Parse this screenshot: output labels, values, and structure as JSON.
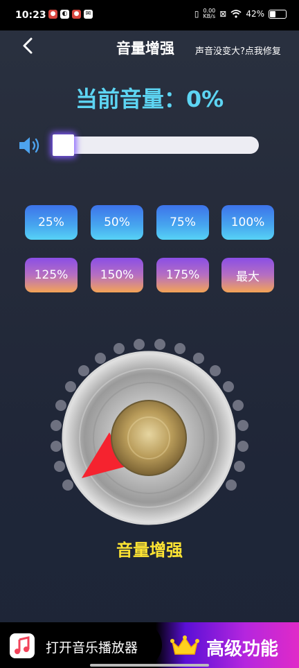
{
  "status_bar": {
    "time": "10:23",
    "notification_icons": [
      "app-notification-icon",
      "app-notification-icon",
      "app-notification-icon",
      "mail-icon"
    ],
    "net_speed_value": "0.00",
    "net_speed_unit": "KB/s",
    "battery": "42%"
  },
  "header": {
    "title": "音量增强",
    "fix_link": "声音没变大?点我修复"
  },
  "volume": {
    "current_label": "当前音量：0%",
    "slider_value": 0
  },
  "presets": {
    "row1": [
      "25%",
      "50%",
      "75%",
      "100%"
    ],
    "row2": [
      "125%",
      "150%",
      "175%",
      "最大"
    ]
  },
  "dial": {
    "label": "音量增强",
    "level": 0
  },
  "bottom": {
    "player_label": "打开音乐播放器",
    "premium_label": "高级功能"
  },
  "colors": {
    "accent_cyan": "#5dd5f3",
    "dial_label_yellow": "#fde433",
    "pointer_red": "#f5232f"
  }
}
